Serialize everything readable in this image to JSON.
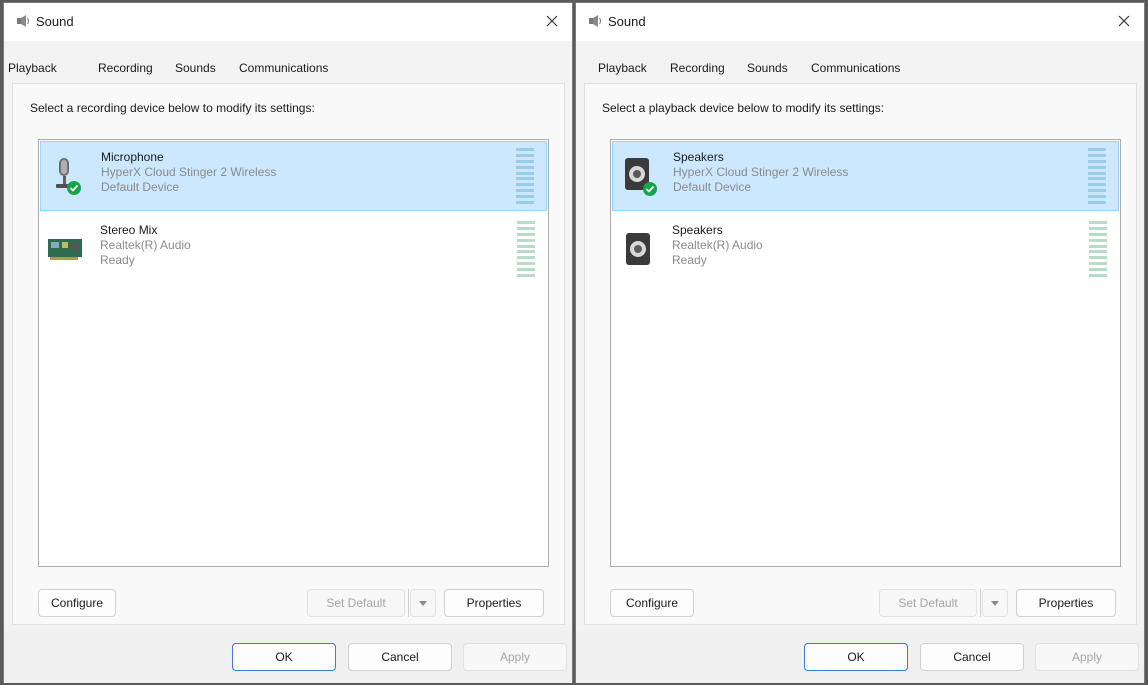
{
  "dialogs": [
    {
      "title": "Sound",
      "tabs": [
        "Playback",
        "Recording",
        "Sounds",
        "Communications"
      ],
      "instruction": "Select a recording device below to modify its settings:",
      "devices": [
        {
          "name": "Microphone",
          "driver": "HyperX Cloud Stinger 2 Wireless",
          "status": "Default Device",
          "selected": true,
          "icon": "microphone-icon"
        },
        {
          "name": "Stereo Mix",
          "driver": "Realtek(R) Audio",
          "status": "Ready",
          "selected": false,
          "icon": "sound-card-icon"
        }
      ],
      "buttons": {
        "configure": "Configure",
        "set_default": "Set Default",
        "properties": "Properties",
        "ok": "OK",
        "cancel": "Cancel",
        "apply": "Apply"
      }
    },
    {
      "title": "Sound",
      "tabs": [
        "Playback",
        "Recording",
        "Sounds",
        "Communications"
      ],
      "instruction": "Select a playback device below to modify its settings:",
      "devices": [
        {
          "name": "Speakers",
          "driver": "HyperX Cloud Stinger 2 Wireless",
          "status": "Default Device",
          "selected": true,
          "icon": "speaker-icon"
        },
        {
          "name": "Speakers",
          "driver": "Realtek(R) Audio",
          "status": "Ready",
          "selected": false,
          "icon": "speaker-icon"
        }
      ],
      "buttons": {
        "configure": "Configure",
        "set_default": "Set Default",
        "properties": "Properties",
        "ok": "OK",
        "cancel": "Cancel",
        "apply": "Apply"
      }
    }
  ],
  "colors": {
    "selected_bg": "#cce8ff",
    "selected_border": "#99d1ff",
    "default_check": "#16a34a"
  }
}
